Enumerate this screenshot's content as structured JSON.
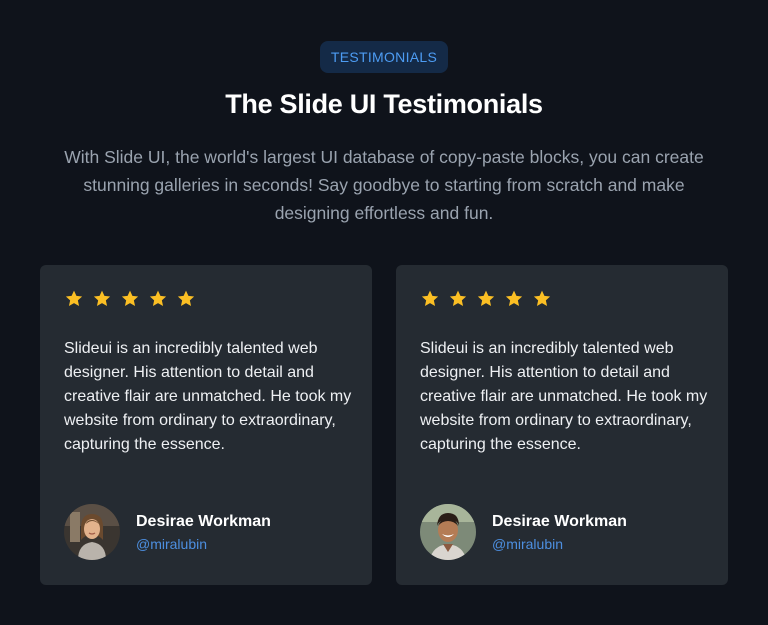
{
  "header": {
    "badge": "TESTIMONIALS",
    "title": "The Slide UI Testimonials",
    "subtitle": "With Slide UI, the world's largest UI database of copy-paste blocks, you can create stunning galleries in seconds! Say goodbye to starting from scratch and make designing effortless and fun."
  },
  "testimonials": [
    {
      "rating": 5,
      "quote": "Slideui is an incredibly talented web designer. His attention to detail and creative flair are unmatched. He took my website from ordinary to extraordinary, capturing the essence.",
      "name": "Desirae Workman",
      "handle": "@miralubin"
    },
    {
      "rating": 5,
      "quote": "Slideui is an incredibly talented web designer. His attention to detail and creative flair are unmatched. He took my website from ordinary to extraordinary, capturing the essence.",
      "name": "Desirae Workman",
      "handle": "@miralubin"
    }
  ],
  "colors": {
    "background": "#0f131b",
    "card": "#252b32",
    "accent": "#4d9cf3",
    "star": "#fbbf24"
  }
}
